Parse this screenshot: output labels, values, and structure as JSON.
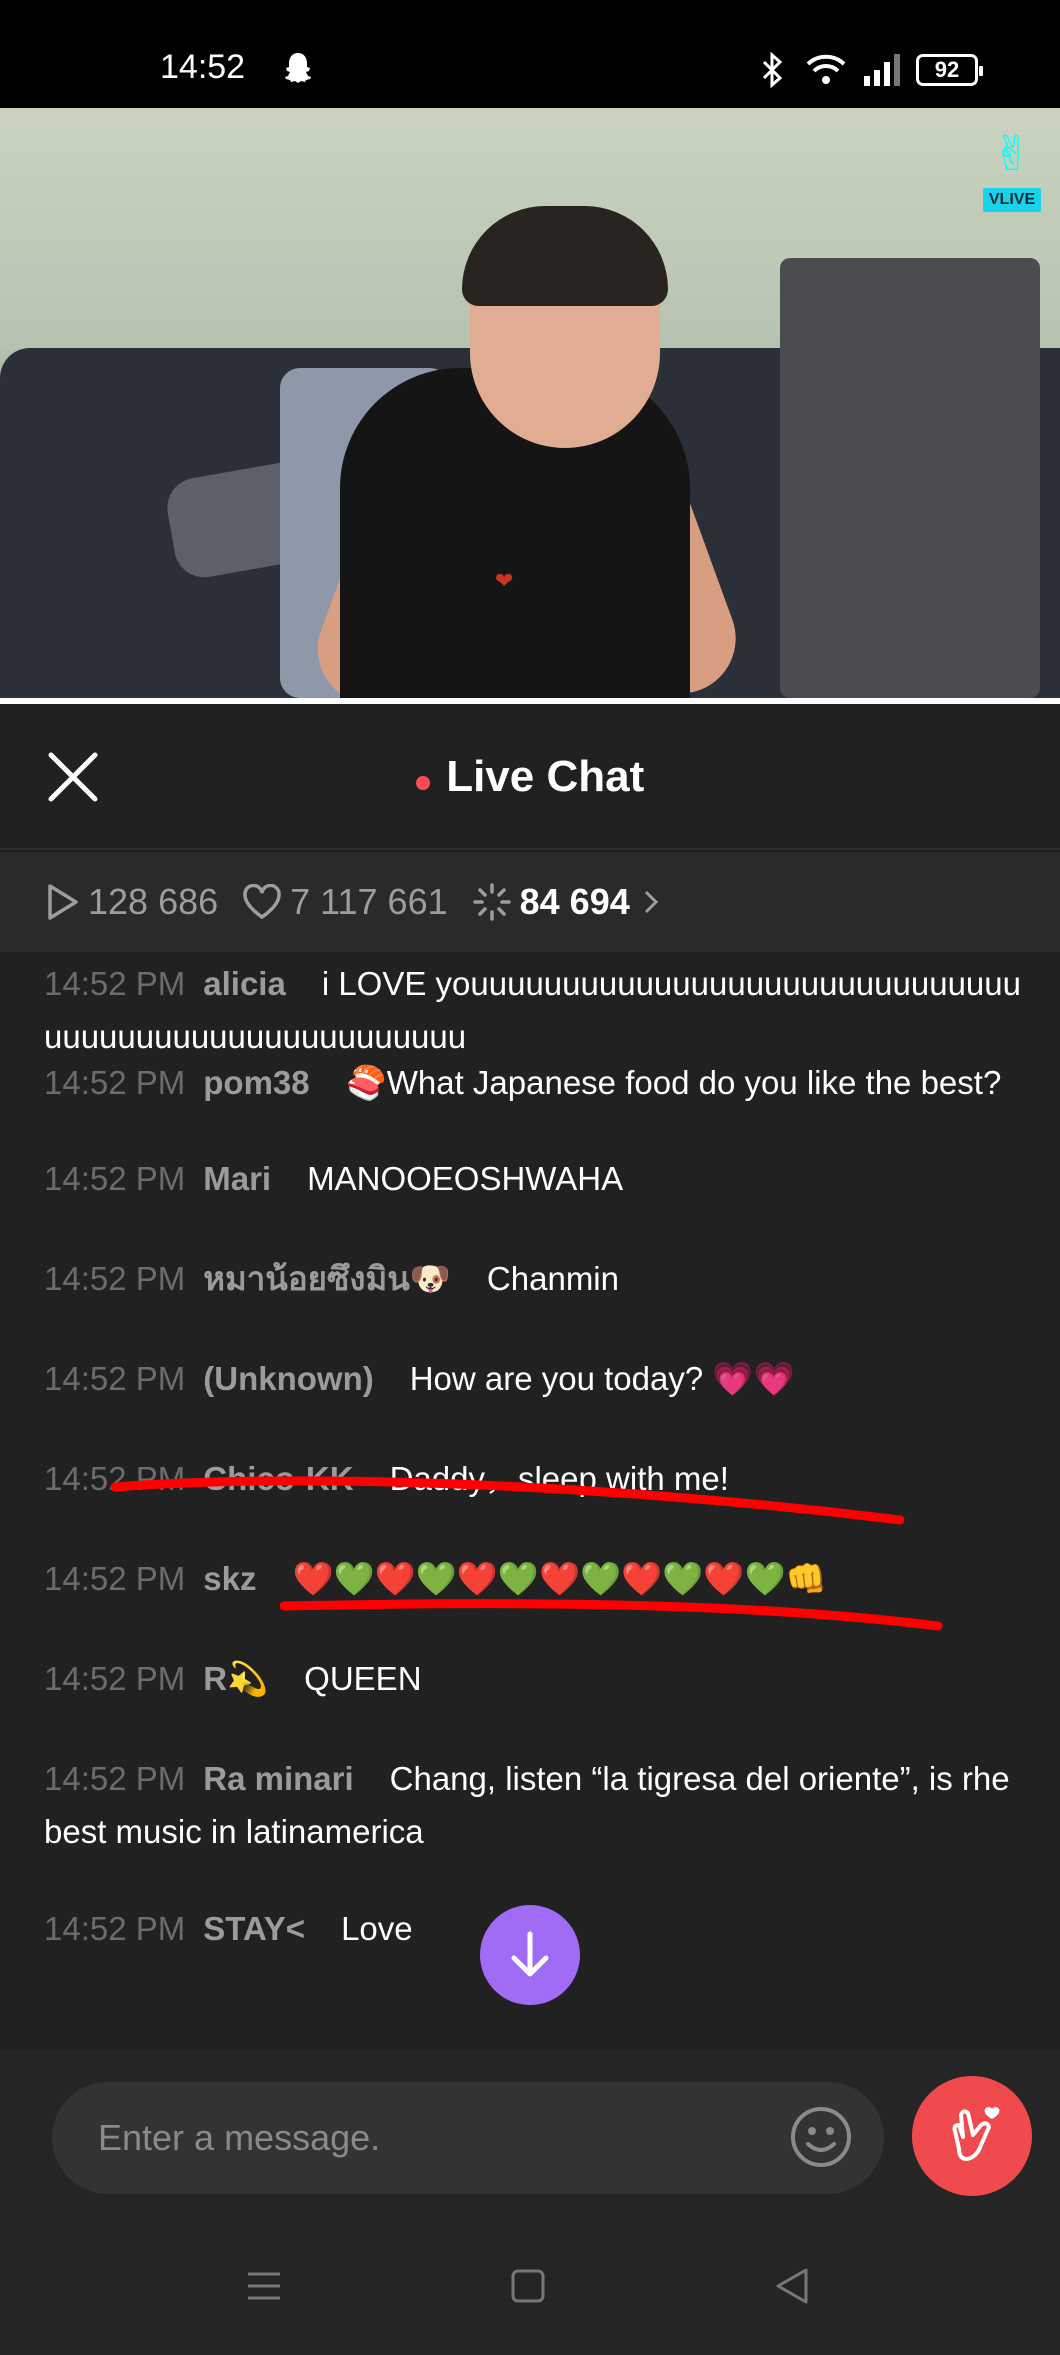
{
  "status_bar": {
    "time": "14:52",
    "battery": "92"
  },
  "video": {
    "badge": "VLIVE"
  },
  "chat_header": {
    "title": "Live Chat",
    "accent_color": "#ff4b55"
  },
  "stats": {
    "plays": "128 686",
    "likes": "7 117 661",
    "sparkles": "84 694"
  },
  "messages": [
    {
      "time": "14:52 PM",
      "user": "alicia",
      "text": "i LOVE youuuuuuuuuuuuuuuuuuuuuuuuuuuuuuuuuuuuuuuuuuuuuuuuuuuuu"
    },
    {
      "time": "14:52 PM",
      "user": "pom38",
      "text": "🍣What Japanese food do you like the best?"
    },
    {
      "time": "14:52 PM",
      "user": "Mari",
      "text": "MANOOEOSHWAHA"
    },
    {
      "time": "14:52 PM",
      "user": "หมาน้อยซึงมิน🐶",
      "text": "Chanmin"
    },
    {
      "time": "14:52 PM",
      "user": "(Unknown)",
      "text": "How are you today? 💗💗"
    },
    {
      "time": "14:52 PM",
      "user": "Chico-KK",
      "text": "Daddy，sleep with me!"
    },
    {
      "time": "14:52 PM",
      "user": "skz",
      "text": "❤️💚❤️💚❤️💚❤️💚❤️💚❤️💚👊"
    },
    {
      "time": "14:52 PM",
      "user": "R💫",
      "text": "QUEEN"
    },
    {
      "time": "14:52 PM",
      "user": "Ra minari",
      "text": "Chang, listen “la tigresa del oriente”, is rhe best music in latinamerica"
    },
    {
      "time": "14:52 PM",
      "user": "STAY<",
      "text": "Love"
    }
  ],
  "input": {
    "placeholder": "Enter a message."
  },
  "colors": {
    "background": "#212121",
    "scroll_button": "#a06cf5",
    "heart_button": "#f04a4f",
    "annotation_red": "#ff0000"
  }
}
